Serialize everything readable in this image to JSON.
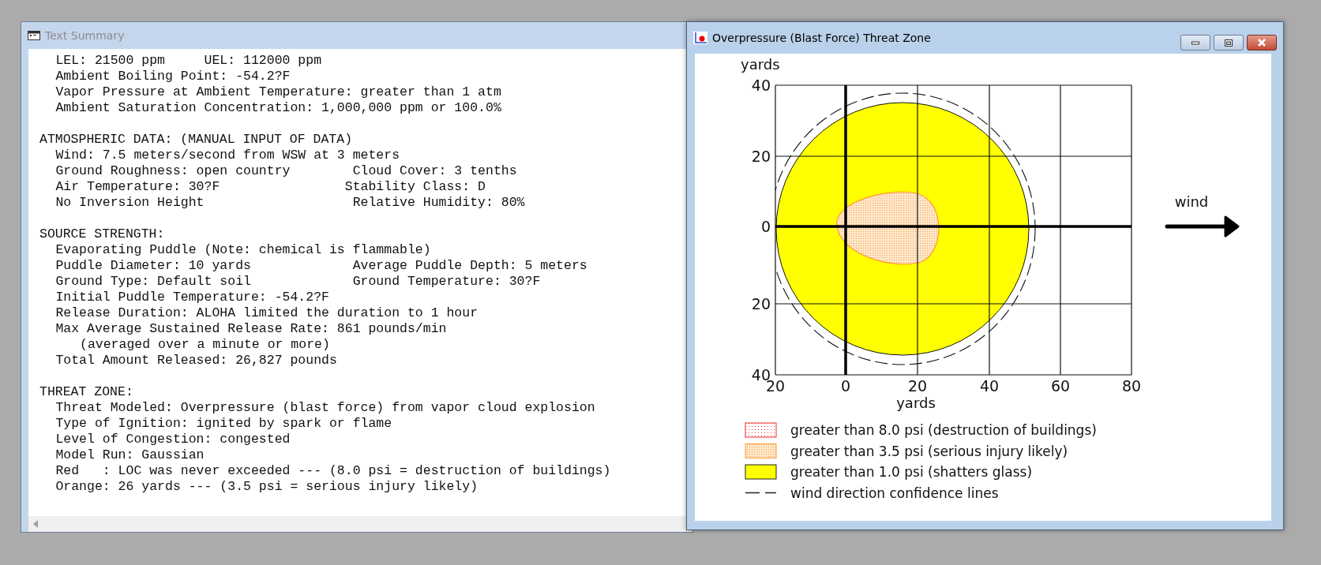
{
  "text_window": {
    "title": "Text Summary",
    "active": false,
    "sections": [
      {
        "lines": [
          {
            "text": "LEL: 21500 ppm     UEL: 112000 ppm"
          },
          {
            "text": "Ambient Boiling Point: -54.2?F"
          },
          {
            "text": "Vapor Pressure at Ambient Temperature: greater than 1 atm"
          },
          {
            "text": "Ambient Saturation Concentration: 1,000,000 ppm or 100.0%"
          }
        ]
      },
      {
        "heading": "ATMOSPHERIC DATA: (MANUAL INPUT OF DATA)",
        "lines": [
          {
            "text": "Wind: 7.5 meters/second from WSW at 3 meters"
          },
          {
            "text": "Ground Roughness: open country        Cloud Cover: 3 tenths"
          },
          {
            "text": "Air Temperature: 30?F                Stability Class: D"
          },
          {
            "text": "No Inversion Height                   Relative Humidity: 80%"
          }
        ]
      },
      {
        "heading": "SOURCE STRENGTH:",
        "lines": [
          {
            "text": "Evaporating Puddle (Note: chemical is flammable)"
          },
          {
            "text": "Puddle Diameter: 10 yards             Average Puddle Depth: 5 meters"
          },
          {
            "text": "Ground Type: Default soil             Ground Temperature: 30?F"
          },
          {
            "text": "Initial Puddle Temperature: -54.2?F"
          },
          {
            "text": "Release Duration: ALOHA limited the duration to 1 hour"
          },
          {
            "text": "Max Average Sustained Release Rate: 861 pounds/min"
          },
          {
            "text": "(averaged over a minute or more)",
            "kind": "continuation"
          },
          {
            "text": "Total Amount Released: 26,827 pounds"
          }
        ]
      },
      {
        "heading": "THREAT ZONE:",
        "lines": [
          {
            "text": "Threat Modeled: Overpressure (blast force) from vapor cloud explosion"
          },
          {
            "text": "Type of Ignition: ignited by spark or flame"
          },
          {
            "text": "Level of Congestion: congested"
          },
          {
            "text": "Model Run: Gaussian"
          },
          {
            "text": "Red   : LOC was never exceeded --- (8.0 psi = destruction of buildings)"
          },
          {
            "text": "Orange: 26 yards --- (3.5 psi = serious injury likely)"
          }
        ]
      }
    ]
  },
  "plot_window": {
    "title": "Overpressure (Blast Force) Threat Zone",
    "active": true,
    "y_label": "yards",
    "x_label": "yards",
    "y_ticks": [
      "40",
      "20",
      "0",
      "20",
      "40"
    ],
    "x_ticks": [
      "20",
      "0",
      "20",
      "40",
      "60",
      "80"
    ],
    "wind_label": "wind",
    "legend": [
      {
        "kind": "dotted-red",
        "label": "greater than 8.0 psi (destruction of buildings)"
      },
      {
        "kind": "dotted-orange",
        "label": "greater than 3.5 psi (serious injury likely)"
      },
      {
        "kind": "solid-yellow",
        "label": "greater than 1.0 psi (shatters glass)"
      },
      {
        "kind": "dashed-line",
        "label": "wind direction confidence lines"
      }
    ]
  }
}
